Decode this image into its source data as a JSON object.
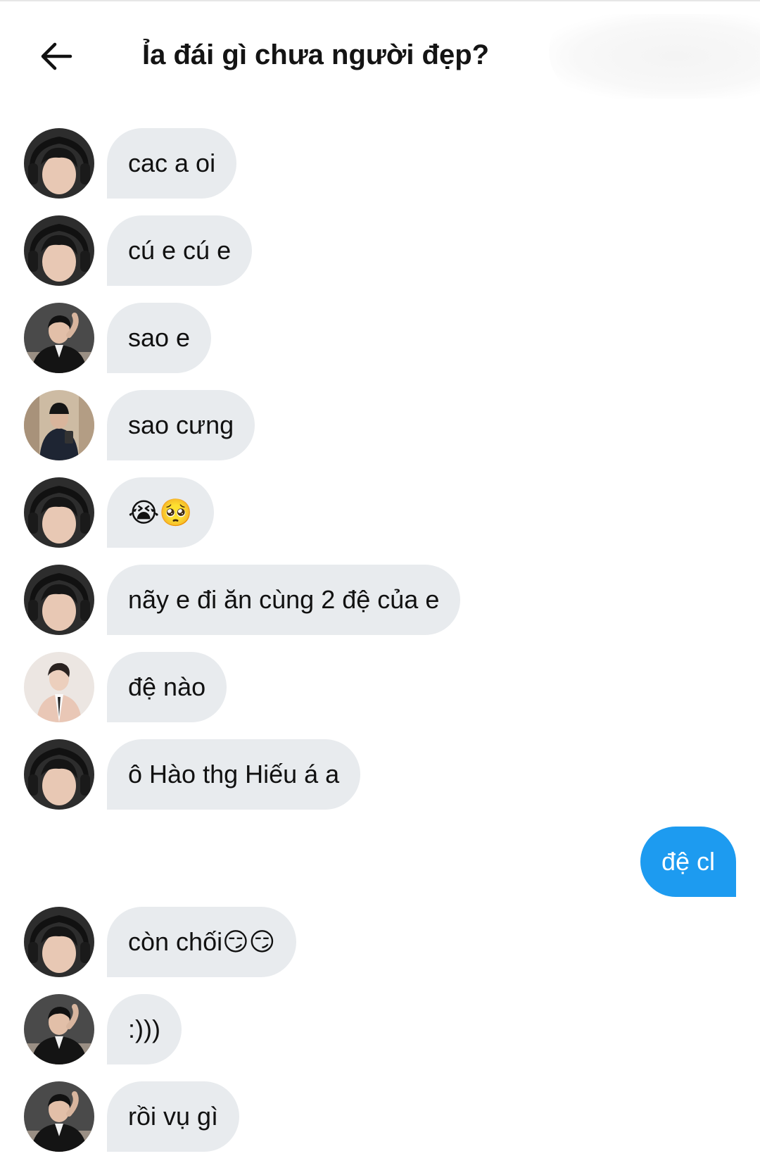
{
  "header": {
    "title": "Ỉa đái gì chưa người đẹp?",
    "back_icon": "arrow-left-icon"
  },
  "messages": [
    {
      "direction": "in",
      "sender": "headphones-user",
      "text": "cac a oi"
    },
    {
      "direction": "in",
      "sender": "headphones-user",
      "text": "cú e cú e"
    },
    {
      "direction": "in",
      "sender": "jacket-user",
      "text": "sao e"
    },
    {
      "direction": "in",
      "sender": "mirror-selfie-user",
      "text": "sao cưng"
    },
    {
      "direction": "in",
      "sender": "headphones-user",
      "text": "😭🥺"
    },
    {
      "direction": "in",
      "sender": "headphones-user",
      "text": "nãy e đi ăn cùng 2 đệ của e"
    },
    {
      "direction": "in",
      "sender": "suit-user",
      "text": "đệ nào"
    },
    {
      "direction": "in",
      "sender": "headphones-user",
      "text": "ô Hào thg Hiếu á a"
    },
    {
      "direction": "out",
      "sender": "me",
      "text": "đệ cl"
    },
    {
      "direction": "in",
      "sender": "headphones-user",
      "text": "còn chối😏😏"
    },
    {
      "direction": "in",
      "sender": "jacket-user",
      "text": ":)))"
    },
    {
      "direction": "in",
      "sender": "jacket-user",
      "text": "rồi vụ gì"
    }
  ],
  "colors": {
    "incoming_bubble": "#e8ebee",
    "outgoing_bubble": "#1d9bf0",
    "text": "#111111"
  }
}
